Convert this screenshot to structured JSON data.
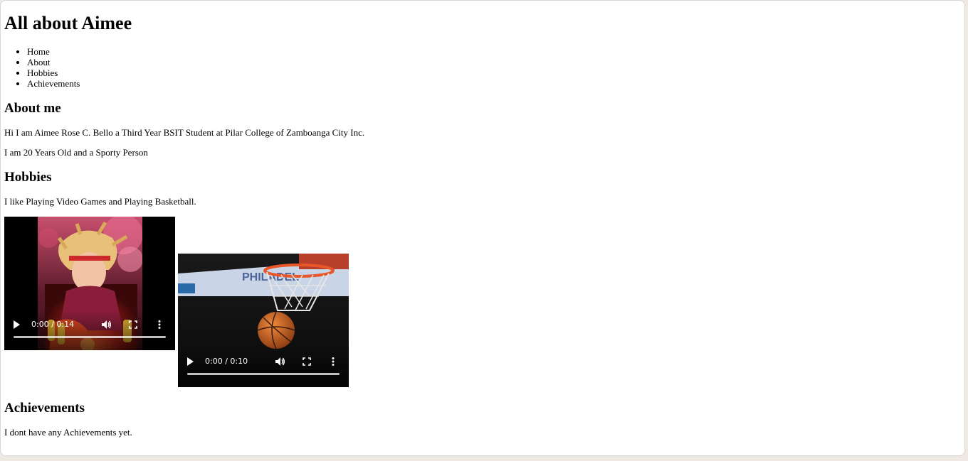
{
  "page": {
    "title": "All about Aimee",
    "nav": [
      "Home",
      "About",
      "Hobbies",
      "Achievements"
    ]
  },
  "about": {
    "heading": "About me",
    "line1": "Hi I am Aimee Rose C. Bello a Third Year BSIT Student at Pilar College of Zamboanga City Inc.",
    "line2": "I am 20 Years Old and a Sporty Person"
  },
  "hobbies": {
    "heading": "Hobbies",
    "text": "I like Playing Video Games and Playing Basketball.",
    "videos": [
      {
        "time": "0:00 / 0:14"
      },
      {
        "time": "0:00 / 0:10"
      }
    ]
  },
  "achievements": {
    "heading": "Achievements",
    "text": "I dont have any Achievements yet."
  }
}
